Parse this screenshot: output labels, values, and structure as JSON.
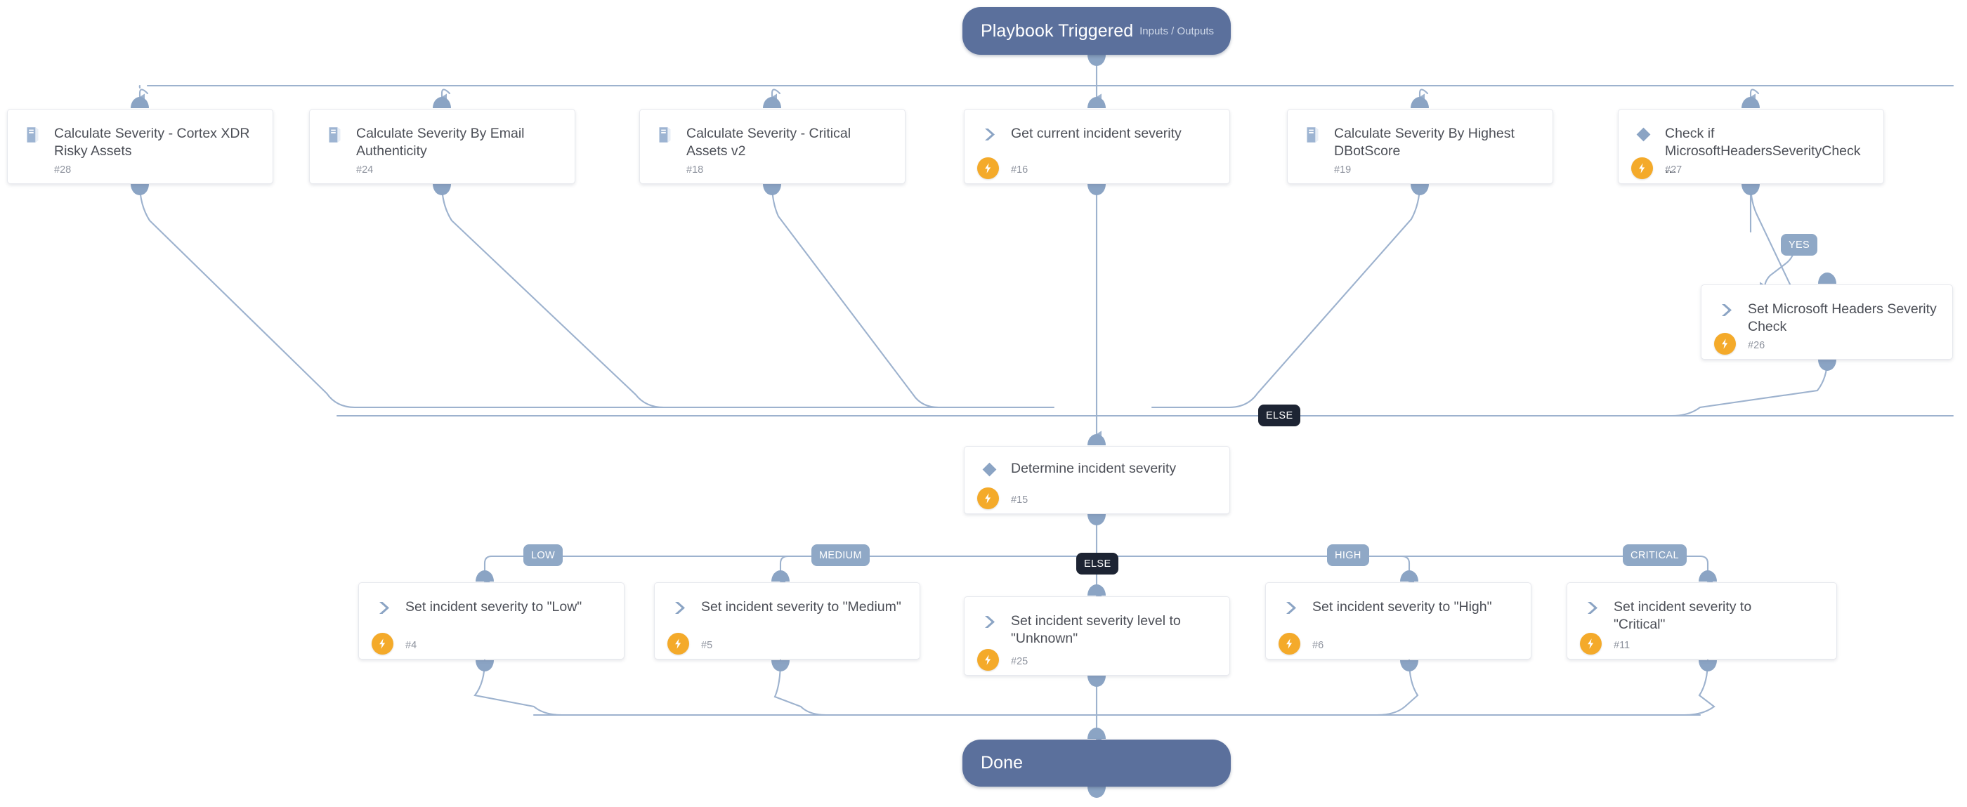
{
  "diagram": {
    "type": "playbook-workflow",
    "title": "Playbook Triggered",
    "colors": {
      "terminal_node": "#5b709c",
      "card_background": "#ffffff",
      "card_border": "#e7e9ee",
      "connector": "#9db2ce",
      "port": "#8ba4c4",
      "branch_label": "#8fa8c6",
      "else_label": "#1d2433",
      "automation_badge": "#f4aa2a",
      "title_text": "#4c4f57",
      "id_text": "#8e939e"
    }
  },
  "trigger": {
    "label": "Playbook Triggered",
    "side_label": "Inputs / Outputs"
  },
  "end": {
    "label": "Done"
  },
  "row_top": [
    {
      "title": "Calculate Severity - Cortex XDR Risky Assets",
      "id": "#28",
      "icon": "playbook-book-icon",
      "automation": false
    },
    {
      "title": "Calculate Severity By Email Authenticity",
      "id": "#24",
      "icon": "playbook-book-icon",
      "automation": false
    },
    {
      "title": "Calculate Severity - Critical Assets v2",
      "id": "#18",
      "icon": "playbook-book-icon",
      "automation": false
    },
    {
      "title": "Get current incident severity",
      "id": "#16",
      "icon": "task-chevron-icon",
      "automation": true
    },
    {
      "title": "Calculate Severity By Highest DBotScore",
      "id": "#19",
      "icon": "playbook-book-icon",
      "automation": false
    },
    {
      "title": "Check if MicrosoftHeadersSeverityCheck ...",
      "id": "#27",
      "icon": "condition-diamond-icon",
      "automation": true
    }
  ],
  "yes_branch": {
    "label": "YES",
    "node": {
      "title": "Set Microsoft Headers Severity Check",
      "id": "#26",
      "icon": "task-chevron-icon",
      "automation": true
    }
  },
  "merge_else": {
    "label": "ELSE"
  },
  "determine": {
    "title": "Determine incident severity",
    "id": "#15",
    "icon": "condition-diamond-icon",
    "automation": true
  },
  "severity_branches": [
    {
      "label": "LOW",
      "style": "cond",
      "title": "Set incident severity to \"Low\"",
      "id": "#4",
      "icon": "task-chevron-icon",
      "automation": true
    },
    {
      "label": "MEDIUM",
      "style": "cond",
      "title": "Set incident severity to \"Medium\"",
      "id": "#5",
      "icon": "task-chevron-icon",
      "automation": true
    },
    {
      "label": "ELSE",
      "style": "els",
      "title": "Set incident severity level to \"Unknown\"",
      "id": "#25",
      "icon": "task-chevron-icon",
      "automation": true
    },
    {
      "label": "HIGH",
      "style": "cond",
      "title": "Set incident severity to \"High\"",
      "id": "#6",
      "icon": "task-chevron-icon",
      "automation": true
    },
    {
      "label": "CRITICAL",
      "style": "cond",
      "title": "Set incident severity to \"Critical\"",
      "id": "#11",
      "icon": "task-chevron-icon",
      "automation": true
    }
  ]
}
